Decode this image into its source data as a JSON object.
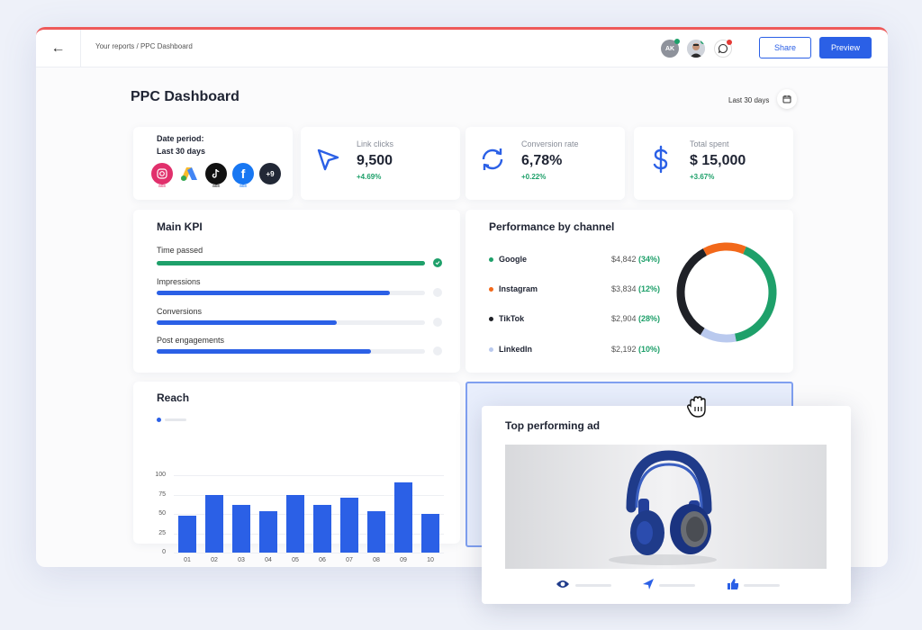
{
  "topbar": {
    "back_icon": "arrow-left-icon",
    "breadcrumb": "Your reports / PPC Dashboard",
    "avatar_initials": "AK",
    "share_label": "Share",
    "preview_label": "Preview",
    "colors": {
      "accent": "#2b60e6",
      "online": "#1ea06a",
      "alert": "#e53935"
    }
  },
  "page": {
    "title": "PPC Dashboard",
    "period_label": "Last 30 days"
  },
  "date_card": {
    "label": "Date period:",
    "value": "Last 30 days",
    "platforms": [
      "Instagram Ads",
      "Google Ads",
      "TikTok Ads",
      "Facebook Ads"
    ],
    "ads_tag": "ads",
    "more": "+9"
  },
  "kpis": [
    {
      "label": "Link clicks",
      "value": "9,500",
      "delta": "+4.69%",
      "icon": "cursor-icon"
    },
    {
      "label": "Conversion rate",
      "value": "6,78%",
      "delta": "+0.22%",
      "icon": "refresh-icon"
    },
    {
      "label": "Total spent",
      "value": "$ 15,000",
      "delta": "+3.67%",
      "icon": "dollar-icon"
    }
  ],
  "main_kpi": {
    "title": "Main KPI",
    "items": [
      {
        "label": "Time passed",
        "progress": 1.0,
        "color": "#1ea06a",
        "done": true
      },
      {
        "label": "Impressions",
        "progress": 0.87,
        "color": "#2b60e6",
        "done": false
      },
      {
        "label": "Conversions",
        "progress": 0.67,
        "color": "#2b60e6",
        "done": false
      },
      {
        "label": "Post engagements",
        "progress": 0.8,
        "color": "#2b60e6",
        "done": false
      }
    ]
  },
  "performance": {
    "title": "Performance by channel",
    "channels": [
      {
        "name": "Google",
        "amount": "$4,842",
        "pct": "(34%)",
        "share": 34,
        "color": "#1ea06a"
      },
      {
        "name": "Instagram",
        "amount": "$3,834",
        "pct": "(12%)",
        "share": 12,
        "color": "#f2681a"
      },
      {
        "name": "TikTok",
        "amount": "$2,904",
        "pct": "(28%)",
        "share": 28,
        "color": "#1f2127"
      },
      {
        "name": "LinkedIn",
        "amount": "$2,192",
        "pct": "(10%)",
        "share": 10,
        "color": "#b9c9ee"
      }
    ]
  },
  "reach": {
    "title": "Reach",
    "chart_data": {
      "type": "bar",
      "categories": [
        "01",
        "02",
        "03",
        "04",
        "05",
        "06",
        "07",
        "08",
        "09",
        "10"
      ],
      "values": [
        48,
        74,
        62,
        53,
        74,
        62,
        71,
        53,
        91,
        50
      ],
      "yticks": [
        "100",
        "75",
        "50",
        "25",
        "0"
      ],
      "ylim": [
        0,
        100
      ],
      "color": "#2b60e6"
    }
  },
  "top_ad": {
    "title": "Top performing ad",
    "image": "blue-headphones",
    "stat_icons": [
      "eye-icon",
      "send-icon",
      "thumbs-up-icon"
    ]
  },
  "cursor_icon": "grab-hand-icon"
}
